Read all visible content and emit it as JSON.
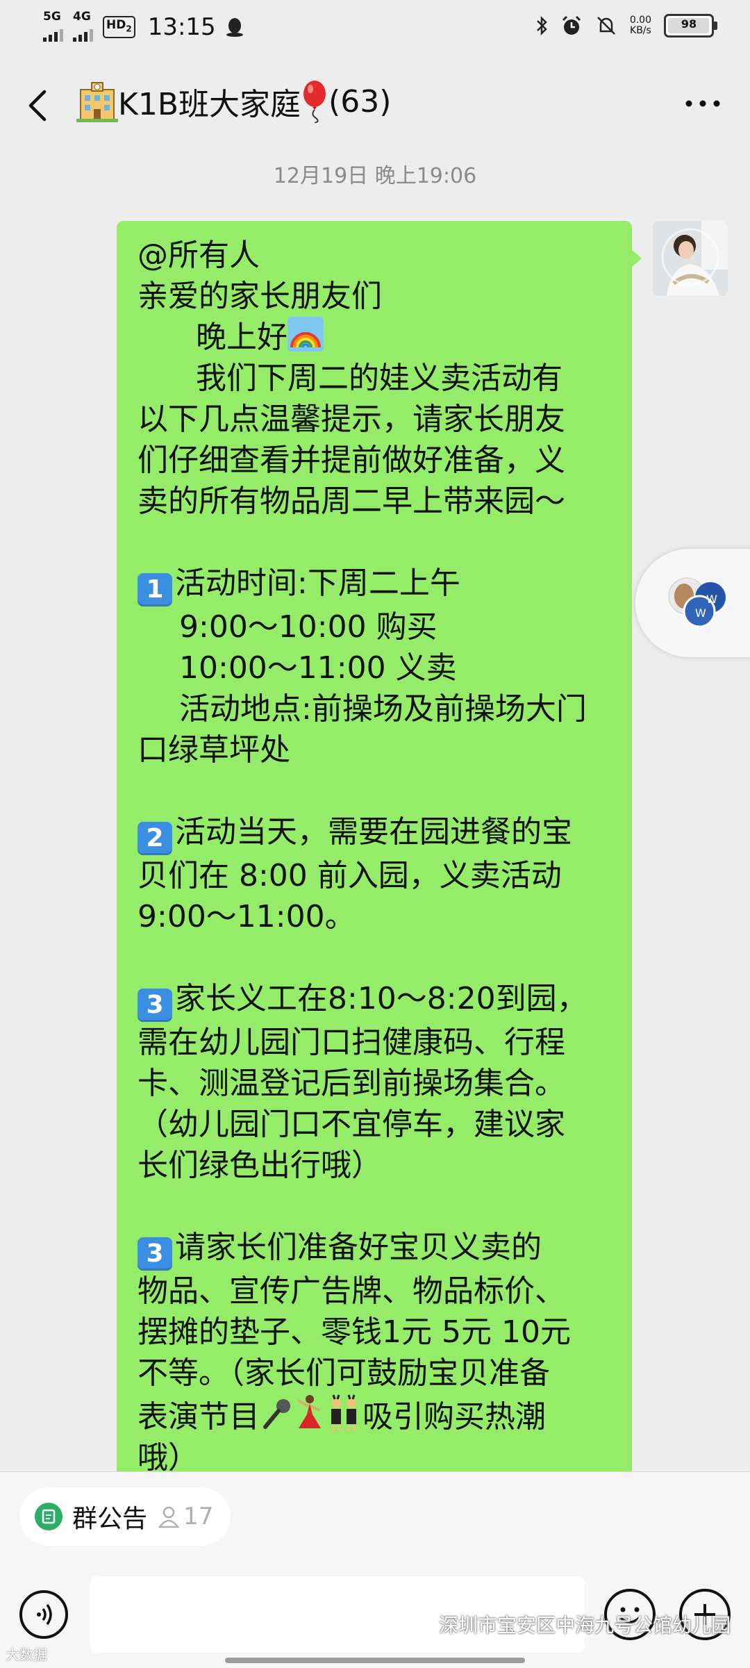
{
  "status_bar": {
    "net1": "5G",
    "net2": "4G",
    "hd": "HD",
    "hd_sub": "2",
    "time": "13:15",
    "speed_value": "0.00",
    "speed_unit": "KB/s",
    "battery": "98",
    "battery_level_percent": 98
  },
  "header": {
    "title": "K1B班大家庭",
    "member_count": "(63)"
  },
  "chat": {
    "timestamp": "12月19日 晚上19:06",
    "message": {
      "lines": {
        "l1": "@所有人",
        "l2": "亲爱的家长朋友们",
        "l3": "晚上好",
        "l4": "我们下周二的娃义卖活动有",
        "l5": "以下几点温馨提示，请家长朋友",
        "l6": "们仔细查看并提前做好准备，义",
        "l7": "卖的所有物品周二早上带来园～",
        "s1_num": "1",
        "s1_l1": "活动时间:下周二上午",
        "s1_l2": "9:00～10:00 购买",
        "s1_l3": "10:00～11:00 义卖",
        "s1_l4": "活动地点:前操场及前操场大门",
        "s1_l5": "口绿草坪处",
        "s2_num": "2",
        "s2_l1": "活动当天，需要在园进餐的宝",
        "s2_l2": "贝们在 8:00 前入园，义卖活动",
        "s2_l3": "9:00～11:00。",
        "s3_num": "3",
        "s3_l1": "家长义工在8:10～8:20到园，",
        "s3_l2": "需在幼儿园门口扫健康码、行程",
        "s3_l3": "卡、测温登记后到前操场集合。",
        "s3_l4": "（幼儿园门口不宜停车，建议家",
        "s3_l5": "长们绿色出行哦）",
        "s4_num": "3",
        "s4_l1": "请家长们准备好宝贝义卖的",
        "s4_l2": "物品、宣传广告牌、物品标价、",
        "s4_l3": "摆摊的垫子、零钱1元 5元 10元",
        "s4_l4": "不等。（家长们可鼓励宝贝准备",
        "s4_l5a": "表演节目",
        "s4_l5b": "吸引购买热潮",
        "s4_l6": "哦）"
      }
    }
  },
  "bottom": {
    "notice_label": "群公告",
    "notice_count": "17"
  },
  "watermark": {
    "text": "深圳市宝安区中海九号公馆幼儿园",
    "corner": "大数据"
  },
  "colors": {
    "bubble": "#95ec69",
    "background": "#ededed",
    "keycap": "#3b8fe0"
  }
}
